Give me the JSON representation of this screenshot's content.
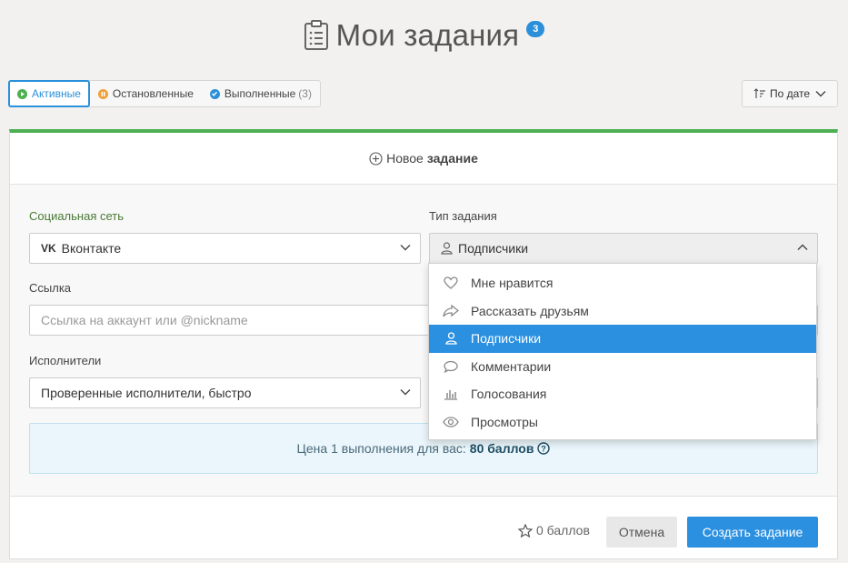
{
  "header": {
    "title": "Мои задания",
    "badge": "3"
  },
  "filters": [
    {
      "label": "Активные",
      "count": ""
    },
    {
      "label": "Остановленные",
      "count": ""
    },
    {
      "label": "Выполненные",
      "count": "(3)"
    }
  ],
  "sort": {
    "label": "По дате"
  },
  "card": {
    "header_prefix": "Новое",
    "header_bold": "задание"
  },
  "form": {
    "social_label": "Социальная сеть",
    "social_value": "Вконтакте",
    "type_label": "Тип задания",
    "type_value": "Подписчики",
    "link_label": "Ссылка",
    "link_placeholder": "Ссылка на аккаунт или @nickname",
    "performers_label": "Исполнители",
    "performers_value": "Проверенные исполнители, быстро"
  },
  "price": {
    "text": "Цена 1 выполнения для вас:",
    "value": "80 баллов"
  },
  "footer": {
    "points": "0 баллов",
    "cancel": "Отмена",
    "create": "Создать задание"
  },
  "dropdown": {
    "items": [
      {
        "label": "Мне нравится",
        "icon": "heart-icon"
      },
      {
        "label": "Рассказать друзьям",
        "icon": "share-icon"
      },
      {
        "label": "Подписчики",
        "icon": "user-icon"
      },
      {
        "label": "Комментарии",
        "icon": "comment-icon"
      },
      {
        "label": "Голосования",
        "icon": "poll-icon"
      },
      {
        "label": "Просмотры",
        "icon": "eye-icon"
      }
    ],
    "selected": "Подписчики"
  },
  "colors": {
    "accent": "#2b90e0",
    "active_bar": "#4caf50",
    "stopped": "#f0a03c"
  }
}
